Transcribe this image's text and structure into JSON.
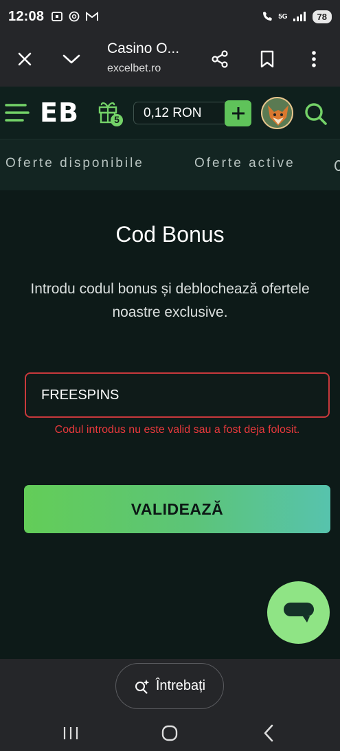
{
  "status_bar": {
    "time": "12:08",
    "network": "5G",
    "battery": "78"
  },
  "browser": {
    "title": "Casino O...",
    "url": "excelbet.ro",
    "icons": [
      "close-icon",
      "chevron-down-icon",
      "share-icon",
      "bookmark-icon",
      "more-vert-icon"
    ]
  },
  "header": {
    "logo": "EB",
    "gift_count": "5",
    "balance": "0,12 RON",
    "icons": [
      "menu-icon",
      "gift-icon",
      "plus-icon",
      "avatar",
      "search-icon"
    ]
  },
  "tabs": [
    {
      "label": "Oferte disponibile"
    },
    {
      "label": "Oferte active"
    }
  ],
  "main": {
    "title": "Cod Bonus",
    "subtitle": "Introdu codul bonus și deblochează ofertele noastre exclusive.",
    "code_value": "FREESPINS",
    "error": "Codul introdus nu este valid sau a fost deja folosit.",
    "validate_label": "VALIDEAZĂ"
  },
  "assistant": {
    "ask_label": "Întrebați"
  },
  "colors": {
    "accent_green": "#5fc35a",
    "error_red": "#e8393c",
    "background": "#0d1a18"
  }
}
